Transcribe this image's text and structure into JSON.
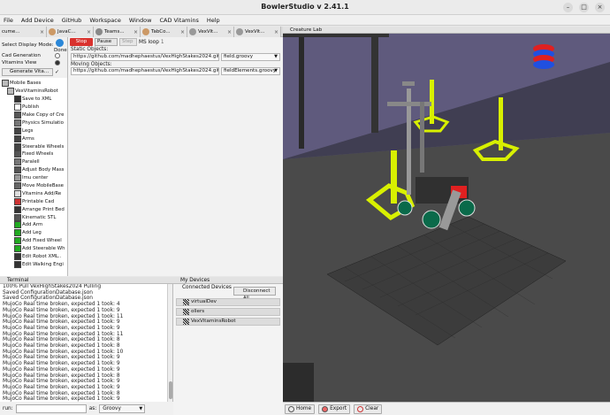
{
  "window": {
    "title": "BowlerStudio v 2.41.1"
  },
  "menu": [
    "File",
    "Add Device",
    "GitHub",
    "Workspace",
    "Window",
    "CAD Vitamins",
    "Help"
  ],
  "left_tabs": [
    {
      "label": "cume..."
    },
    {
      "label": "JavaC..."
    },
    {
      "label": "Teams..."
    },
    {
      "label": "TabCo..."
    },
    {
      "label": "VexVit..."
    },
    {
      "label": "VexVit..."
    }
  ],
  "controls": {
    "display_mode_label": "Select Display Mode:",
    "done_label": "Done",
    "cad_generation": "Cad Generation",
    "vitamins_view": "Vitamins View",
    "generate_button": "Generate Vita..."
  },
  "tree": [
    "Mobile Bases",
    "VexVitaminsRobot",
    "Save to XML",
    "Publish",
    "Make Copy of Cre",
    "Physics Simulatio",
    "Legs",
    "Arms",
    "Steerable Wheels",
    "Fixed Wheels",
    "Paralell",
    "Adjust Body Mass",
    "Imu center",
    "Move MobileBase",
    "Vitamins Add/Re",
    "Printable Cad",
    "Arrange Print Bed",
    "Kinematic STL",
    "Add Arm",
    "Add Leg",
    "Add Fixed Wheel",
    "Add Steerable Wh",
    "Edit Robot XML..",
    "Edit Walking Engi"
  ],
  "creature": {
    "stop_label": "Stop",
    "pause_label": "Pause",
    "step_label": "Step",
    "ms_loop_label": "MS loop",
    "ms_loop_value": "1",
    "static_label": "Static Objects:",
    "static_url": "https://github.com/madhephaestus/VexHighStakes2024.git",
    "static_file": "field.groovy",
    "moving_label": "Moving Objects:",
    "moving_url": "https://github.com/madhephaestus/VexHighStakes2024.git",
    "moving_file": "fieldElements.groovy"
  },
  "view": {
    "tab_label": "Creature Lab",
    "home_label": "Home",
    "export_label": "Export",
    "clear_label": "Clear"
  },
  "terminal": {
    "tab_label": "Terminal",
    "lines": [
      "100% Pull VexHighStakes2024 Pulling",
      "Saved ConfigurationDatabase.json",
      "Saved ConfigurationDatabase.json",
      "MujoCo Real time broken, expected 1 took: 4",
      "MujoCo Real time broken, expected 1 took: 9",
      "MujoCo Real time broken, expected 1 took: 11",
      "MujoCo Real time broken, expected 1 took: 9",
      "MujoCo Real time broken, expected 1 took: 9",
      "MujoCo Real time broken, expected 1 took: 11",
      "MujoCo Real time broken, expected 1 took: 8",
      "MujoCo Real time broken, expected 1 took: 8",
      "MujoCo Real time broken, expected 1 took: 10",
      "MujoCo Real time broken, expected 1 took: 9",
      "MujoCo Real time broken, expected 1 took: 9",
      "MujoCo Real time broken, expected 1 took: 9",
      "MujoCo Real time broken, expected 1 took: 8",
      "MujoCo Real time broken, expected 1 took: 9",
      "MujoCo Real time broken, expected 1 took: 9",
      "MujoCo Real time broken, expected 1 took: 8",
      "MujoCo Real time broken, expected 1 took: 9",
      "MujoCo Real time broken, expected 1 took: 9",
      "MujoCo Real time broken, expected 1 took: 9"
    ],
    "run_label": "run:",
    "as_label": "as:",
    "language": "Groovy"
  },
  "devices": {
    "tab_label": "My Devices",
    "connected_label": "Connected Devices",
    "disconnect_label": "Disconnect All",
    "items": [
      "virtualDev",
      "ollers",
      "VexVitaminsRobot"
    ]
  }
}
